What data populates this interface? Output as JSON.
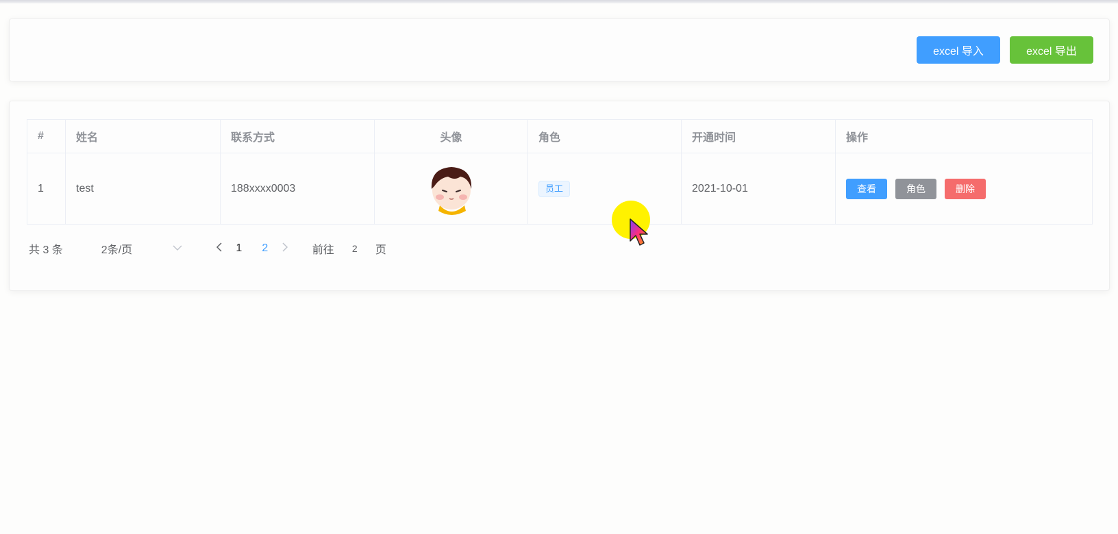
{
  "toolbar": {
    "import_label": "excel 导入",
    "export_label": "excel 导出"
  },
  "table": {
    "headers": [
      "#",
      "姓名",
      "联系方式",
      "头像",
      "角色",
      "开通时间",
      "操作"
    ],
    "rows": [
      {
        "index": "1",
        "name": "test",
        "contact": "188xxxx0003",
        "role": "员工",
        "open_date": "2021-10-01"
      }
    ],
    "actions": {
      "view": "查看",
      "role": "角色",
      "delete": "删除"
    }
  },
  "pagination": {
    "total": "共 3 条",
    "page_size": "2条/页",
    "pages": [
      "1",
      "2"
    ],
    "current_page": "2",
    "goto_label": "前往",
    "goto_value": "2",
    "page_suffix": "页"
  },
  "colors": {
    "primary": "#409eff",
    "success": "#67c23a",
    "info": "#909399",
    "danger": "#f56c6c"
  }
}
